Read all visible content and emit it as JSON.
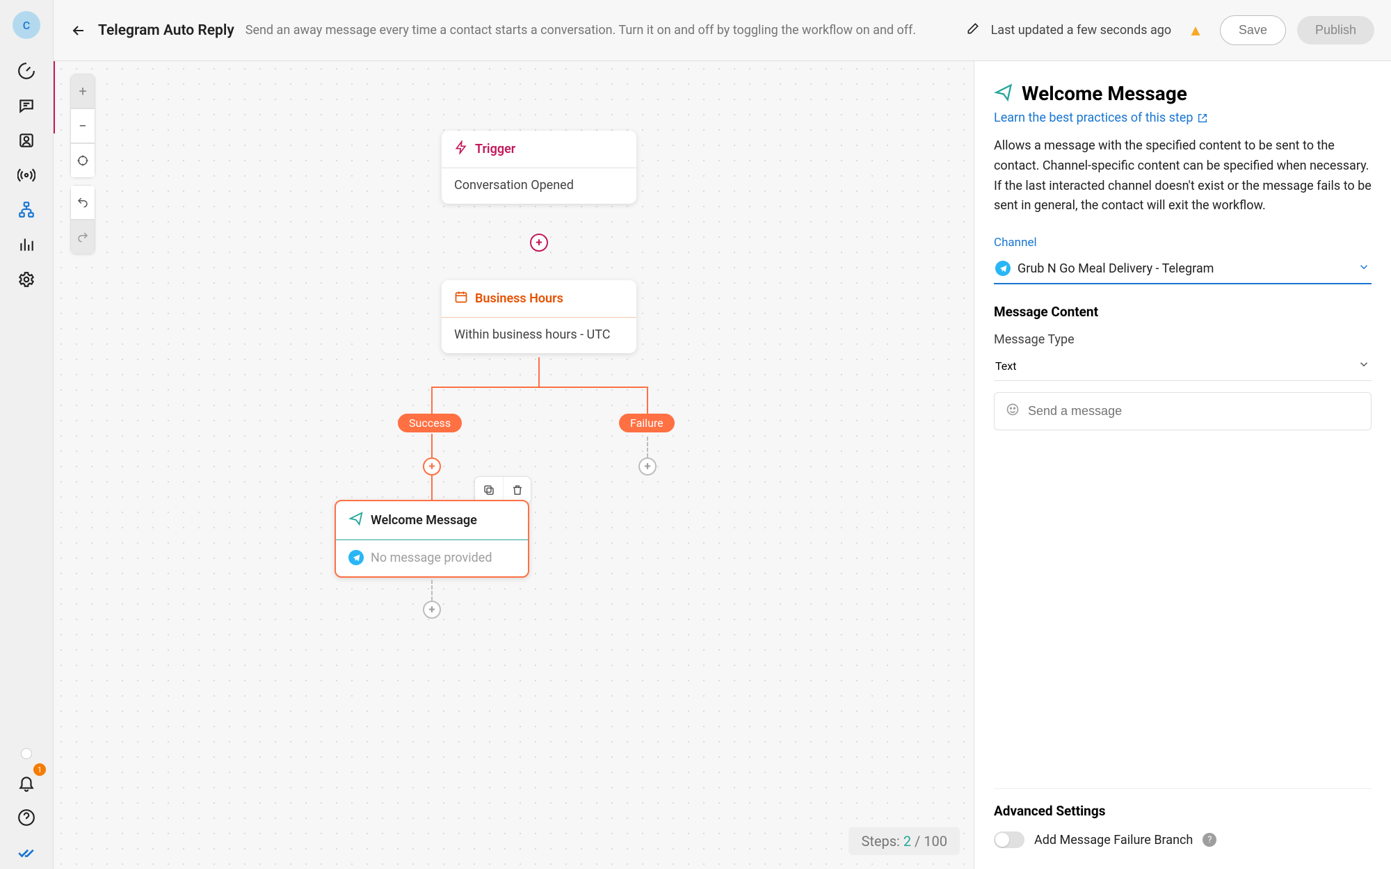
{
  "avatar": "C",
  "bell_badge": "1",
  "header": {
    "title": "Telegram Auto Reply",
    "desc": "Send an away message every time a contact starts a conversation. Turn it on and off by toggling the workflow on and off.",
    "last_updated": "Last updated a few seconds ago",
    "save": "Save",
    "publish": "Publish"
  },
  "canvas": {
    "trigger": {
      "title": "Trigger",
      "body": "Conversation Opened"
    },
    "hours": {
      "title": "Business Hours",
      "body": "Within business hours - UTC"
    },
    "branch": {
      "success": "Success",
      "failure": "Failure"
    },
    "welcome": {
      "title": "Welcome Message",
      "body": "No message provided"
    },
    "steps_label": "Steps: ",
    "steps_cur": "2",
    "steps_total": " / 100"
  },
  "panel": {
    "title": "Welcome Message",
    "learn": "Learn the best practices of this step",
    "desc": "Allows a message with the specified content to be sent to the contact. Channel-specific content can be specified when necessary. If the last interacted channel doesn't exist or the message fails to be sent in general, the contact will exit the workflow.",
    "channel_label": "Channel",
    "channel_value": "Grub N Go Meal Delivery - Telegram",
    "content_title": "Message Content",
    "msg_type_label": "Message Type",
    "msg_type_value": "Text",
    "msg_placeholder": "Send a message",
    "adv_title": "Advanced Settings",
    "adv_toggle_label": "Add Message Failure Branch"
  }
}
